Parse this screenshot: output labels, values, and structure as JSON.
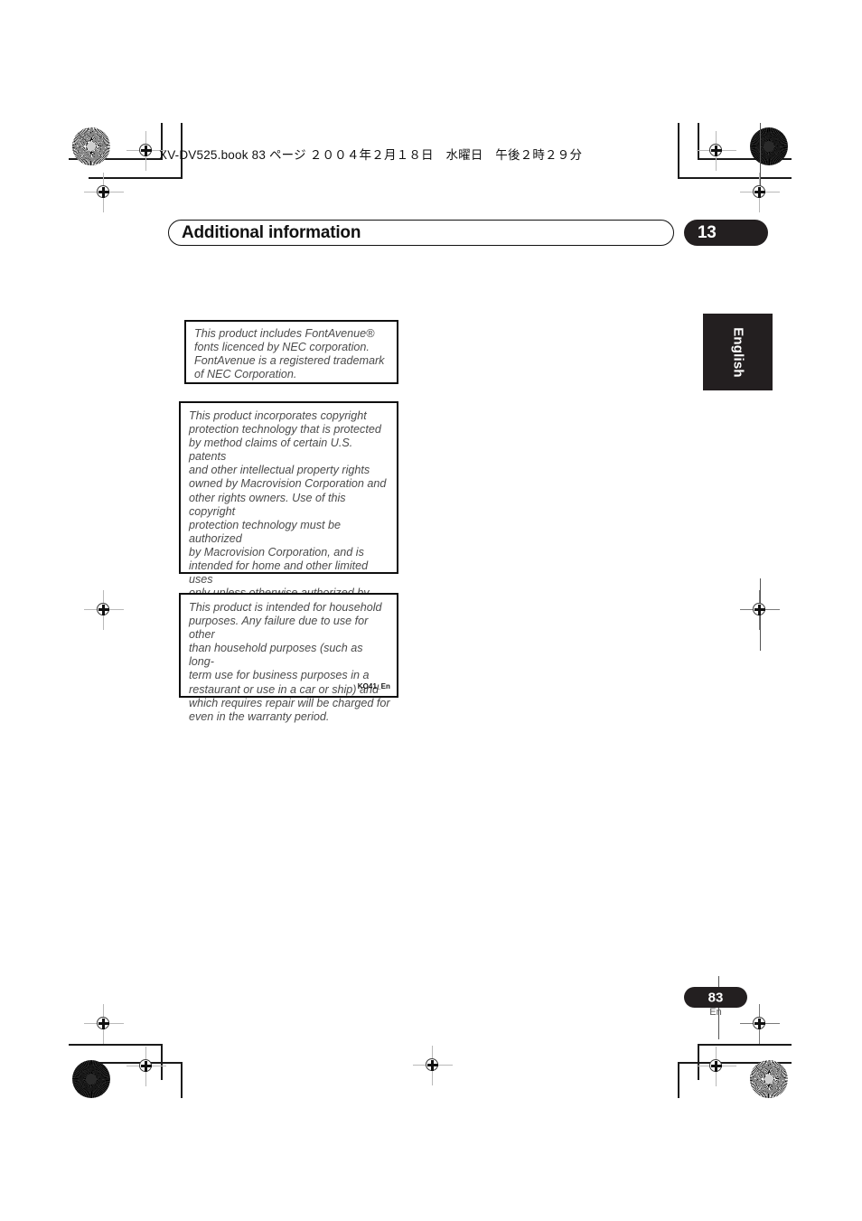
{
  "page": {
    "book_header": "XV-DV525.book  83 ページ  ２００４年２月１８日　水曜日　午後２時２９分",
    "chapter_title": "Additional information",
    "chapter_number": "13",
    "language_tab": "English",
    "page_number": "83",
    "page_language": "En"
  },
  "notices": {
    "fontavenue": {
      "text": "This product includes FontAvenue®\nfonts licenced by NEC corporation.\nFontAvenue is a registered trademark\nof NEC Corporation."
    },
    "macrovision": {
      "text": "This product incorporates copyright\nprotection technology that is protected\nby method claims of certain U.S. patents\nand other intellectual property rights\nowned by Macrovision Corporation and\nother rights owners. Use of this copyright\nprotection technology must be authorized\nby Macrovision Corporation, and is\nintended for home and other limited uses\nonly unless otherwise authorized by\nMacrovision Corporation. Reverse\nengineering or disassembly is prohibited."
    },
    "household": {
      "text": "This product is intended for household\npurposes. Any failure due to use for other\nthan household purposes (such as long-\nterm use for business purposes in a\nrestaurant or use in a car or ship) and\nwhich requires repair will be charged for\neven in the warranty period.",
      "code": "KO41_En"
    }
  },
  "colors": {
    "ink": "#231f20",
    "body_text": "#4b4b4b",
    "paper": "#ffffff"
  }
}
